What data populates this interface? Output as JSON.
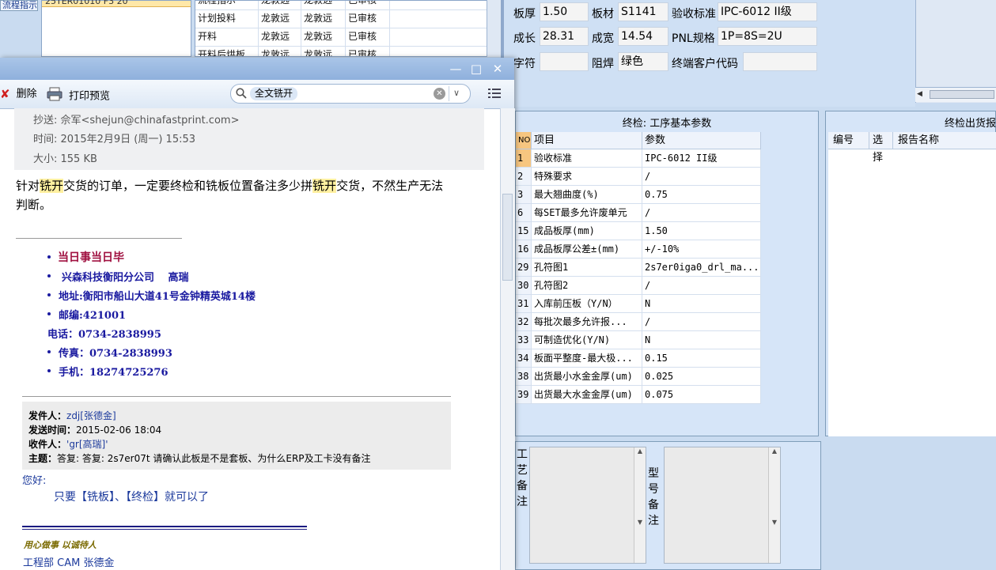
{
  "erp": {
    "flow_button": "流程指示",
    "left_grid_row": "25TER01010  F3  20",
    "process_rows": [
      {
        "name": "流程指示",
        "user1": "龙敦远",
        "user2": "龙敦远",
        "status": "已审核"
      },
      {
        "name": "计划投料",
        "user1": "龙敦远",
        "user2": "龙敦远",
        "status": "已审核"
      },
      {
        "name": "开料",
        "user1": "龙敦远",
        "user2": "龙敦远",
        "status": "已审核"
      },
      {
        "name": "开料后烘板",
        "user1": "龙敦远",
        "user2": "龙敦远",
        "status": "已审核"
      }
    ],
    "info": {
      "board_thickness_label": "板厚",
      "board_thickness": "1.50",
      "material_label": "板材",
      "material": "S1141",
      "acceptance_label": "验收标准",
      "acceptance": "IPC-6012 II级",
      "length_label": "成长",
      "length": "28.31",
      "width_label": "成宽",
      "width": "14.54",
      "pnl_label": "PNL规格",
      "pnl": "1P=8S=2U",
      "char_label": "字符",
      "char": "",
      "mask_label": "阻焊",
      "mask": "绿色",
      "customer_code_label": "终端客户代码",
      "customer_code": ""
    },
    "inspection": {
      "title": "终检: 工序基本参数",
      "headers": {
        "no": "NO",
        "item": "项目",
        "param": "参数"
      },
      "rows": [
        {
          "no": "1",
          "item": "验收标准",
          "param": "IPC-6012 II级"
        },
        {
          "no": "2",
          "item": "特殊要求",
          "param": "/"
        },
        {
          "no": "3",
          "item": "最大翘曲度(%)",
          "param": "0.75"
        },
        {
          "no": "6",
          "item": "每SET最多允许废单元",
          "param": "/"
        },
        {
          "no": "15",
          "item": "成品板厚(mm)",
          "param": "1.50"
        },
        {
          "no": "16",
          "item": "成品板厚公差±(mm)",
          "param": "+/-10%"
        },
        {
          "no": "29",
          "item": "孔符图1",
          "param": "2s7er0iga0_drl_ma..."
        },
        {
          "no": "30",
          "item": "孔符图2",
          "param": "/"
        },
        {
          "no": "31",
          "item": "入库前压板（Y/N）",
          "param": "N"
        },
        {
          "no": "32",
          "item": "每批次最多允许报...",
          "param": "/"
        },
        {
          "no": "33",
          "item": "可制造优化(Y/N)",
          "param": "N"
        },
        {
          "no": "34",
          "item": "板面平整度-最大极...",
          "param": "0.15"
        },
        {
          "no": "38",
          "item": "出货最小水金金厚(um)",
          "param": "0.025"
        },
        {
          "no": "39",
          "item": "出货最大水金金厚(um)",
          "param": "0.075"
        }
      ]
    },
    "report": {
      "title": "终检出货报告",
      "headers": [
        "编号",
        "选择",
        "报告名称"
      ]
    },
    "notes": {
      "process_note_label": "工艺备注",
      "model_note_label": "型号备注"
    }
  },
  "mail": {
    "toolbar": {
      "delete_label": "删除",
      "print_preview_label": "打印预览",
      "search_tag": "全文铣开"
    },
    "header": {
      "cc": "抄送: 佘军<shejun@chinafastprint.com>",
      "time": "时间: 2015年2月9日 (周一) 15:53",
      "size": "大小: 155 KB"
    },
    "body": {
      "line1_a": "针对",
      "line1_hl1": "铣开",
      "line1_b": "交货的订单，一定要终检和铣板位置备注多少拼",
      "line1_hl2": "铣开",
      "line1_c": "交货，不然生产无法",
      "line2": "判断。"
    },
    "signature": {
      "motto": "当日事当日毕",
      "company": "兴森科技衡阳分公司　 高瑞",
      "address": "地址:衡阳市船山大道41号金钟精英城14楼",
      "postcode": "邮编:421001",
      "phone": "电话：0734-2838995",
      "fax": "传真：0734-2838993",
      "mobile": "手机：18274725276"
    },
    "quote": {
      "from_label": "发件人：",
      "from": "zdj[张德金]",
      "sent_label": "发送时间：",
      "sent": "2015-02-06 18:04",
      "to_label": "收件人：",
      "to": "'gr[高瑞]'",
      "subject_label": "主题：",
      "subject": "答复: 答复: 2s7er07t 请确认此板是不是套板、为什么ERP及工卡没有备注",
      "greeting": "您好:",
      "reply": "只要【铣板】、【终检】就可以了"
    },
    "footer": {
      "motto": "用心做事 以诚待人",
      "dept": "工程部 CAM 张德金"
    }
  }
}
